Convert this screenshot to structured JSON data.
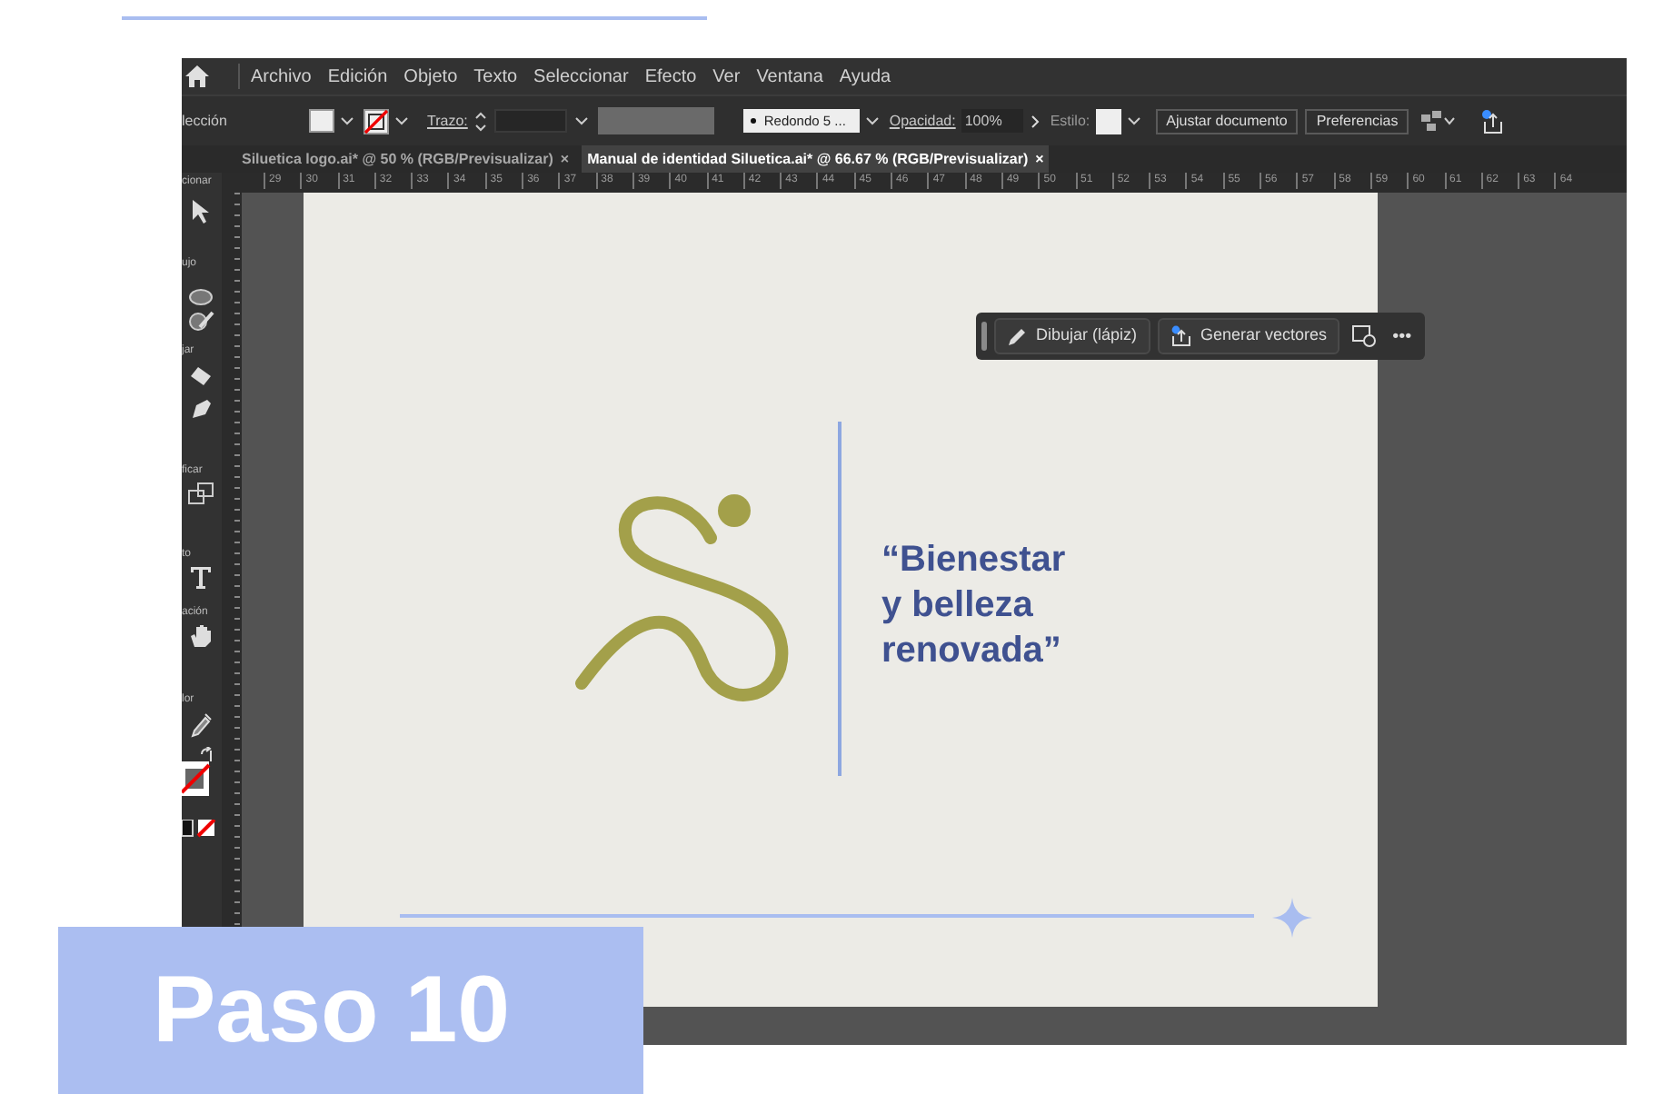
{
  "menu": [
    "Archivo",
    "Edición",
    "Objeto",
    "Texto",
    "Seleccionar",
    "Efecto",
    "Ver",
    "Ventana",
    "Ayuda"
  ],
  "control_bar": {
    "label": "lección",
    "stroke_label": "Trazo:",
    "brush": "Redondo 5 ...",
    "opacity_label": "Opacidad:",
    "opacity": "100%",
    "style_label": "Estilo:",
    "buttons": [
      "Ajustar documento",
      "Preferencias"
    ]
  },
  "tabs": [
    {
      "label": "Siluetica logo.ai* @ 50 % (RGB/Previsualizar)",
      "close": "×",
      "selected": false
    },
    {
      "label": "Manual de identidad Siluetica.ai* @ 66.67 % (RGB/Previsualizar)",
      "close": "×",
      "selected": true
    }
  ],
  "ruler": [
    "29",
    "30",
    "31",
    "32",
    "33",
    "34",
    "35",
    "36",
    "37",
    "38",
    "39",
    "40",
    "41",
    "42",
    "43",
    "44",
    "45",
    "46",
    "47",
    "48",
    "49",
    "50",
    "51",
    "52",
    "53",
    "54",
    "55",
    "56",
    "57",
    "58",
    "59",
    "60",
    "61",
    "62",
    "63",
    "64"
  ],
  "toolbar_labels": [
    "cionar",
    "ujo",
    "jar",
    "ficar",
    "to",
    "ación",
    "lor"
  ],
  "context_bar": {
    "buttons": [
      "Dibujar (lápiz)",
      "Generar vectores"
    ],
    "more": "•••"
  },
  "artboard": {
    "tagline": [
      "“Bienestar",
      "y belleza",
      "renovada”"
    ]
  },
  "step_badge": "Paso 10"
}
